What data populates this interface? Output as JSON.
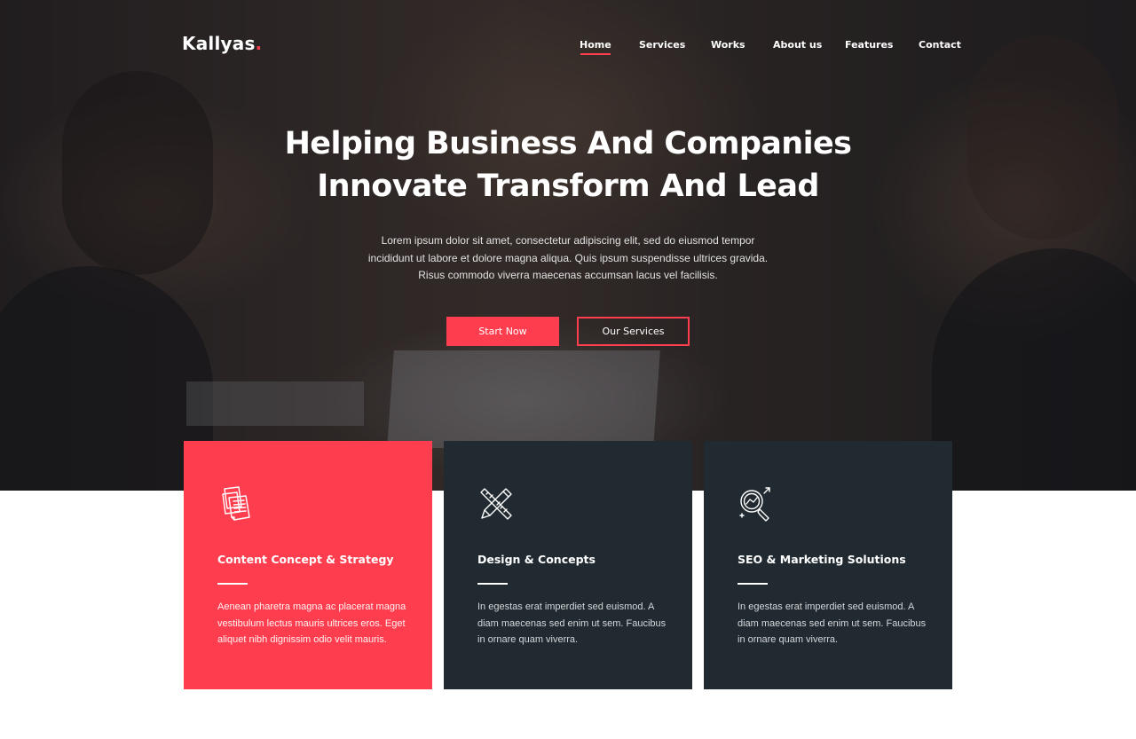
{
  "brand": {
    "name": "Kallyas",
    "dot": ".",
    "accent_color": "#fe3e4f",
    "dark_color": "#212a30"
  },
  "nav": {
    "items": [
      {
        "label": "Home",
        "active": true
      },
      {
        "label": "Services",
        "active": false
      },
      {
        "label": "Works",
        "active": false
      },
      {
        "label": "About us",
        "active": false
      },
      {
        "label": "Features",
        "active": false
      },
      {
        "label": "Contact",
        "active": false
      }
    ]
  },
  "hero": {
    "title_line1": "Helping Business And Companies",
    "title_line2": "Innovate Transform And Lead",
    "description": "Lorem ipsum dolor sit amet, consectetur adipiscing elit, sed do eiusmod tempor incididunt ut labore et dolore magna aliqua. Quis ipsum suspendisse ultrices gravida. Risus commodo viverra maecenas accumsan lacus vel facilisis.",
    "primary_button": "Start Now",
    "secondary_button": "Our Services"
  },
  "features": [
    {
      "icon": "documents-icon",
      "title": "Content Concept & Strategy",
      "text": "Aenean pharetra magna ac placerat magna vestibulum lectus mauris ultrices eros. Eget aliquet nibh dignissim odio velit mauris."
    },
    {
      "icon": "ruler-pencil-icon",
      "title": "Design & Concepts",
      "text": "In egestas erat imperdiet sed euismod. A diam maecenas sed enim ut sem. Faucibus in ornare quam viverra."
    },
    {
      "icon": "seo-magnifier-icon",
      "title": "SEO & Marketing Solutions",
      "text": "In egestas erat imperdiet sed euismod. A diam maecenas sed enim ut sem. Faucibus in ornare quam viverra."
    }
  ]
}
